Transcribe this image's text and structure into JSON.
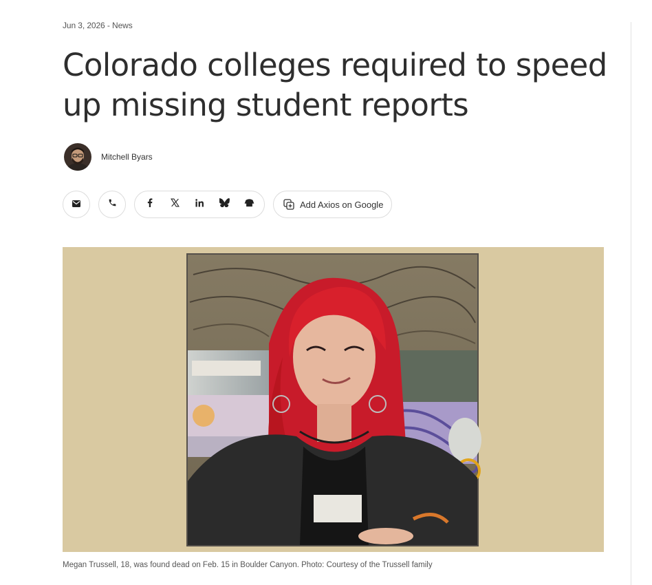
{
  "article": {
    "date": "Jun 3, 2026",
    "separator": " - ",
    "category": "News",
    "headline": "Colorado colleges required to speed up missing student reports",
    "author": "Mitchell Byars",
    "caption": "Megan Trussell, 18, was found dead on Feb. 15 in Boulder Canyon. Photo: Courtesy of the Trussell family"
  },
  "share": {
    "email_icon": "mail-icon",
    "sms_icon": "phone-icon",
    "social_icons": [
      "facebook-icon",
      "x-icon",
      "linkedin-icon",
      "bluesky-icon",
      "mastodon-icon"
    ],
    "google_label": "Add Axios on Google",
    "google_icon": "add-source-icon"
  },
  "colors": {
    "photo_background": "#d9c9a1",
    "hair": "#d8202c",
    "headline": "#2e2e2e"
  }
}
